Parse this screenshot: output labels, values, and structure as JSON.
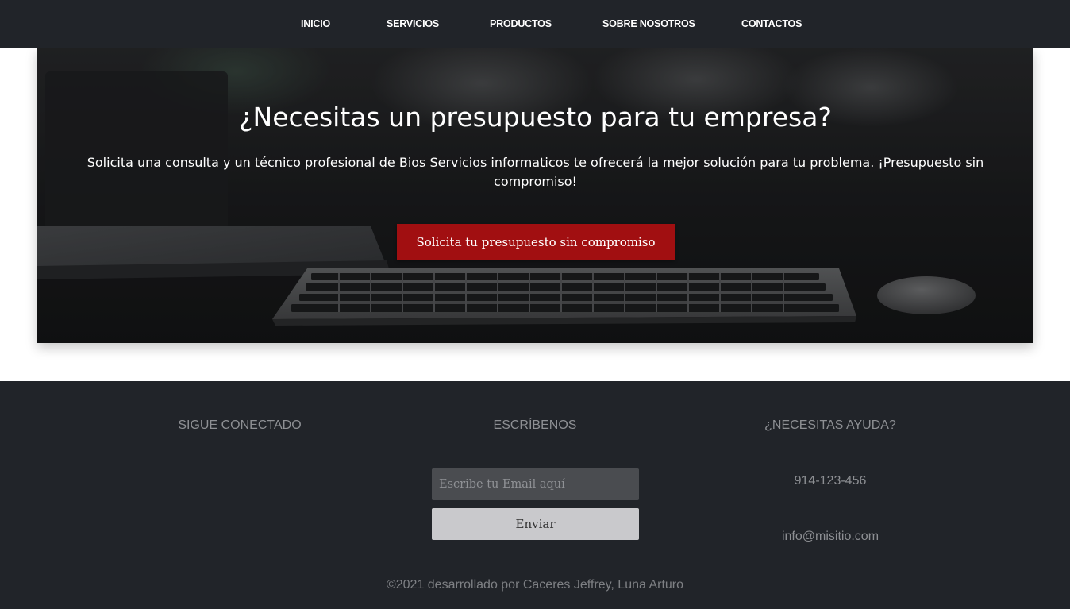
{
  "nav": {
    "items": [
      {
        "label": "INICIO"
      },
      {
        "label": "SERVICIOS"
      },
      {
        "label": "PRODUCTOS"
      },
      {
        "label": "SOBRE NOSOTROS"
      },
      {
        "label": "CONTACTOS"
      }
    ]
  },
  "hero": {
    "title": "¿Necesitas un presupuesto para tu empresa?",
    "subtitle": "Solicita una consulta y un técnico profesional de Bios Servicios informaticos te ofrecerá la mejor solución para tu problema. ¡Presupuesto sin compromiso!",
    "button_label": "Solicita tu presupuesto sin compromiso",
    "button_color": "#a10f11"
  },
  "footer": {
    "social_heading": "SIGUE CONECTADO",
    "write_heading": "ESCRÍBENOS",
    "help_heading": "¿NECESITAS AYUDA?",
    "email_placeholder": "Escribe tu Email aquí",
    "send_label": "Enviar",
    "phone": "914-123-456",
    "email": "info@misitio.com",
    "copyright": "©2021 desarrollado por Caceres Jeffrey, Luna Arturo"
  },
  "colors": {
    "navbar_bg": "#212429",
    "footer_bg": "#212429",
    "accent": "#a10f11"
  }
}
